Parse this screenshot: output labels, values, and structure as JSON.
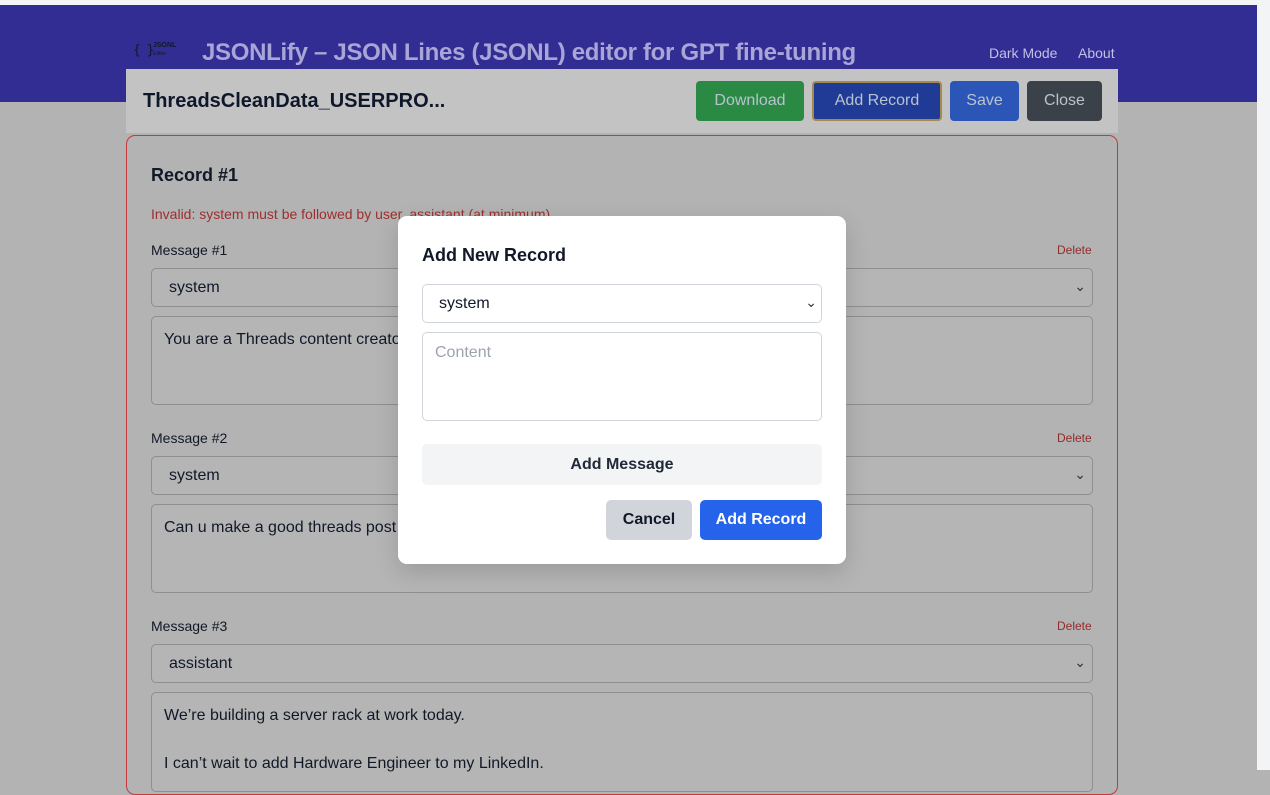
{
  "header": {
    "logo_text_1": "JSONL",
    "logo_text_2": "Editor",
    "title": "JSONLify – JSON Lines (JSONL) editor for GPT fine-tuning",
    "nav": [
      "Dark Mode",
      "About"
    ]
  },
  "toolbar": {
    "filename": "ThreadsCleanData_USERPRO...",
    "download_label": "Download",
    "add_record_label": "Add Record",
    "save_label": "Save",
    "close_label": "Close"
  },
  "record": {
    "title": "Record #1",
    "error": "Invalid: system must be followed by user, assistant (at minimum)",
    "delete_label": "Delete",
    "messages": [
      {
        "label": "Message #1",
        "role": "system",
        "content": "You are a Threads content creator"
      },
      {
        "label": "Message #2",
        "role": "system",
        "content": "Can u make a good threads post"
      },
      {
        "label": "Message #3",
        "role": "assistant",
        "content": "We’re building a server rack at work today.\n\nI can’t wait to add Hardware Engineer to my LinkedIn."
      }
    ]
  },
  "modal": {
    "title": "Add New Record",
    "role_value": "system",
    "content_placeholder": "Content",
    "add_message_label": "Add Message",
    "cancel_label": "Cancel",
    "add_record_label": "Add Record"
  },
  "colors": {
    "header": "#322d93",
    "download": "#2a8a43",
    "add_record": "#1f3b95",
    "save": "#2b56b8",
    "close": "#3b4148",
    "modal_primary": "#2563eb",
    "error": "#c23a3a"
  }
}
